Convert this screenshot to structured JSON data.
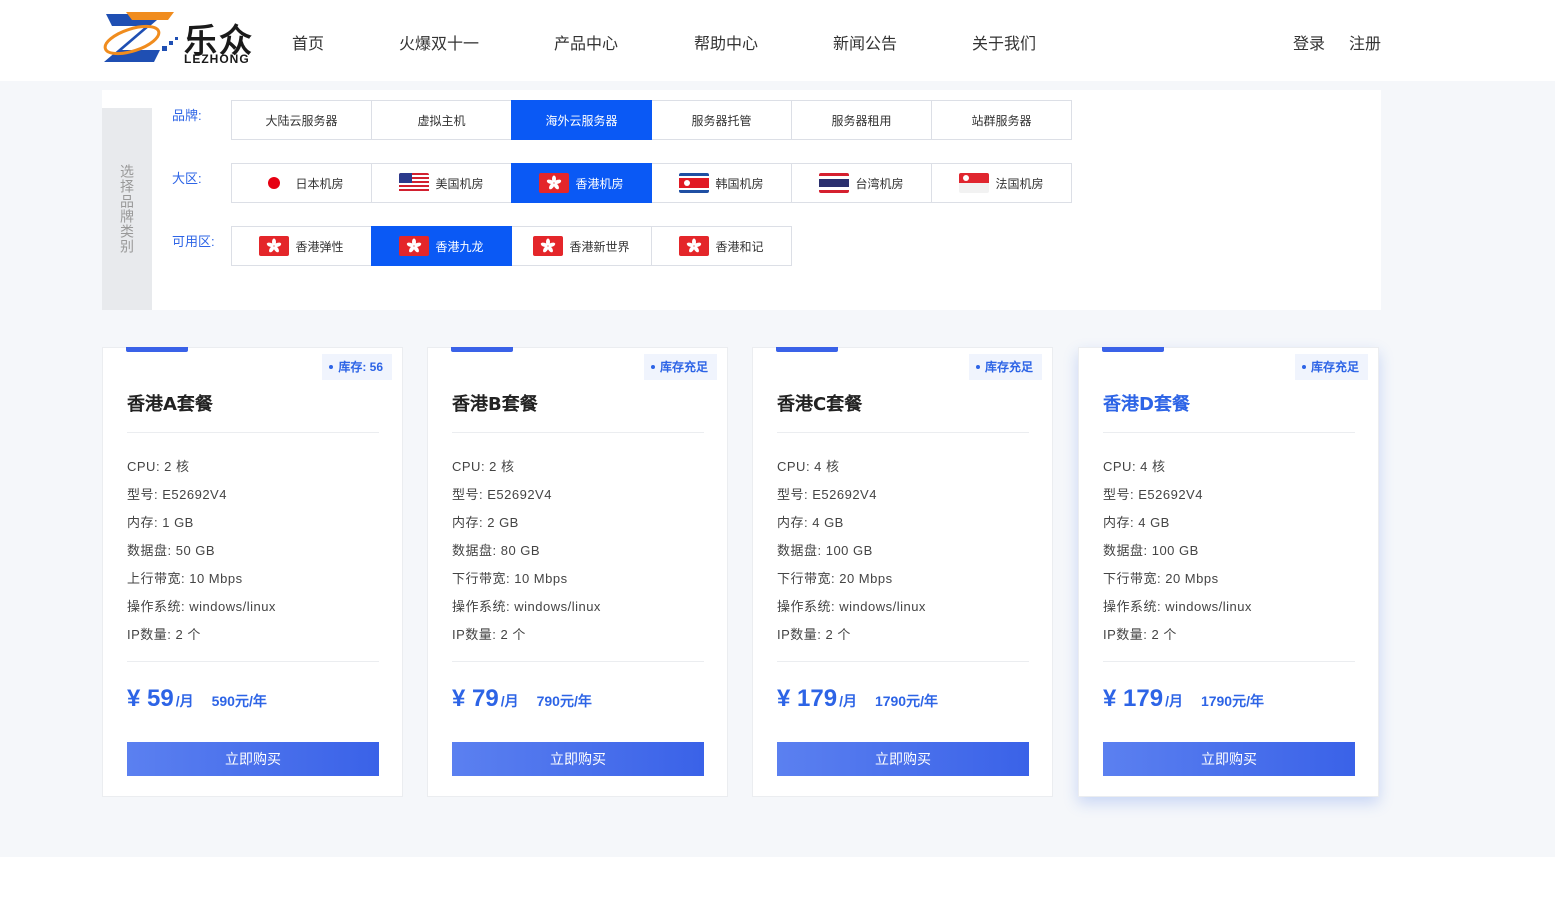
{
  "header": {
    "logo_cn": "乐众",
    "logo_en": "LEZHONG",
    "nav": [
      "首页",
      "火爆双十一",
      "产品中心",
      "帮助中心",
      "新闻公告",
      "关于我们"
    ],
    "login": "登录",
    "register": "注册"
  },
  "filter": {
    "side_label": "选择品牌类别",
    "brand_label": "品牌:",
    "brands": [
      "大陆云服务器",
      "虚拟主机",
      "海外云服务器",
      "服务器托管",
      "服务器租用",
      "站群服务器"
    ],
    "region_label": "大区:",
    "regions": [
      "日本机房",
      "美国机房",
      "香港机房",
      "韩国机房",
      "台湾机房",
      "法国机房"
    ],
    "zone_label": "可用区:",
    "zones": [
      "香港弹性",
      "香港九龙",
      "香港新世界",
      "香港和记"
    ]
  },
  "cards": [
    {
      "stock": "库存: 56",
      "title": "香港A套餐",
      "specs": [
        "CPU:  2 核",
        "型号:  E52692V4",
        "内存:  1 GB",
        "数据盘:  50 GB",
        "上行带宽:  10 Mbps",
        "操作系统:  windows/linux",
        "IP数量:  2 个"
      ],
      "price": "¥ 59",
      "per_month": "/月",
      "per_year": "590元/年",
      "buy": "立即购买"
    },
    {
      "stock": "库存充足",
      "title": "香港B套餐",
      "specs": [
        "CPU:  2 核",
        "型号:  E52692V4",
        "内存:  2 GB",
        "数据盘:  80 GB",
        "下行带宽:  10 Mbps",
        "操作系统:  windows/linux",
        "IP数量:  2 个"
      ],
      "price": "¥ 79",
      "per_month": "/月",
      "per_year": "790元/年",
      "buy": "立即购买"
    },
    {
      "stock": "库存充足",
      "title": "香港C套餐",
      "specs": [
        "CPU:  4 核",
        "型号:  E52692V4",
        "内存:  4 GB",
        "数据盘:  100 GB",
        "下行带宽:  20 Mbps",
        "操作系统:  windows/linux",
        "IP数量:  2 个"
      ],
      "price": "¥ 179",
      "per_month": "/月",
      "per_year": "1790元/年",
      "buy": "立即购买"
    },
    {
      "stock": "库存充足",
      "title": "香港D套餐",
      "specs": [
        "CPU:  4 核",
        "型号:  E52692V4",
        "内存:  4 GB",
        "数据盘:  100 GB",
        "下行带宽:  20 Mbps",
        "操作系统:  windows/linux",
        "IP数量:  2 个"
      ],
      "price": "¥ 179",
      "per_month": "/月",
      "per_year": "1790元/年",
      "buy": "立即购买"
    }
  ],
  "colors": {
    "accent": "#0a59f5",
    "text_blue": "#2d64e6",
    "background": "#f5f7fa"
  }
}
